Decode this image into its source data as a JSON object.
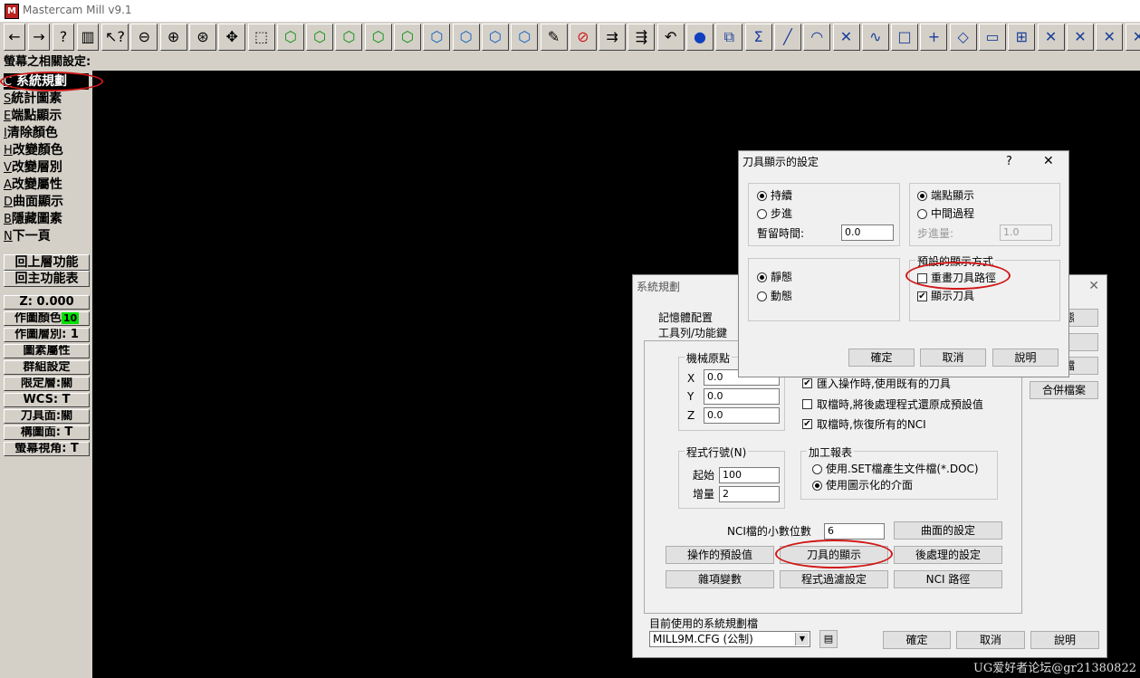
{
  "window": {
    "title": "Mastercam Mill v9.1"
  },
  "toolbar": {
    "buttons": [
      "←",
      "→",
      "?",
      "▥",
      "↖?",
      "⊖",
      "⊕",
      "⊛",
      "✥",
      "⬚",
      "⬡",
      "⬡",
      "⬡",
      "⬡",
      "⬡",
      "⬡",
      "⬡",
      "⬡",
      "⬡",
      "✎",
      "⊘",
      "⇉",
      "⇶",
      "↶",
      "●",
      "⧉",
      "Σ",
      "╱",
      "◠",
      "✕",
      "∿",
      "□",
      "+",
      "◇",
      "▭",
      "⊞",
      "✕",
      "✕",
      "✕",
      "✕"
    ]
  },
  "prompt": "螢幕之相關設定:",
  "left_menu": {
    "items": [
      {
        "key": "C",
        "label": "系統規劃"
      },
      {
        "key": "S",
        "label": "統計圖素"
      },
      {
        "key": "E",
        "label": "端點顯示"
      },
      {
        "key": "I",
        "label": "清除顏色"
      },
      {
        "key": "H",
        "label": "改變顏色"
      },
      {
        "key": "V",
        "label": "改變層別"
      },
      {
        "key": "A",
        "label": "改變屬性"
      },
      {
        "key": "D",
        "label": "曲面顯示"
      },
      {
        "key": "B",
        "label": "隱藏圖素"
      },
      {
        "key": "N",
        "label": "下一頁"
      }
    ],
    "nav": [
      "回上層功能",
      "回主功能表"
    ],
    "status": {
      "z": "Z:  0.000",
      "color": "作圖顏色",
      "color_value": "10",
      "level": "作圖層別:  1",
      "attributes": "圖素屬性",
      "group": "群組設定",
      "mask": "限定層:關",
      "wcs": "WCS:  T",
      "tplane": "刀具面:關",
      "cplane": "構圖面:  T",
      "gview": "螢幕視角:  T"
    }
  },
  "sys_dialog": {
    "title": "系統規劃",
    "tabs": [
      "記憶體配置",
      "工具列/功能鍵"
    ],
    "right_buttons": [
      "狀態",
      "...",
      "新檔",
      "合併檔案"
    ],
    "machine_origin": {
      "title": "機械原點",
      "labels": [
        "X",
        "Y",
        "Z"
      ],
      "values": [
        "0.0",
        "0.0",
        "0.0"
      ]
    },
    "checks": [
      {
        "label": "匯入操作時,使用既有的刀具",
        "checked": true
      },
      {
        "label": "取檔時,將後處理程式還原成預設值",
        "checked": false
      },
      {
        "label": "取檔時,恢復所有的NCI",
        "checked": true
      }
    ],
    "seq": {
      "title": "程式行號(N)",
      "start_label": "起始",
      "start_value": "100",
      "inc_label": "增量",
      "inc_value": "2"
    },
    "report": {
      "title": "加工報表",
      "opts": [
        "使用.SET檔產生文件檔(*.DOC)",
        "使用圖示化的介面"
      ],
      "selected": 1
    },
    "nci_decimals_label": "NCI檔的小數位數",
    "nci_decimals_value": "6",
    "btns": [
      "曲面的設定",
      "操作的預設值",
      "刀具的顯示",
      "後處理的設定",
      "雜項變數",
      "程式過濾設定",
      "NCI 路徑"
    ],
    "cfg_label": "目前使用的系統規劃檔",
    "cfg_value": "MILL9M.CFG (公制)",
    "ok": "確定",
    "cancel": "取消",
    "help": "說明"
  },
  "tool_dialog": {
    "title": "刀具顯示的設定",
    "help_glyph": "?",
    "close_glyph": "✕",
    "mode": {
      "opts": [
        "持續",
        "步進"
      ],
      "selected": 0,
      "pause_label": "暫留時間:",
      "pause_value": "0.0"
    },
    "display": {
      "opts": [
        "端點顯示",
        "中間過程"
      ],
      "selected": 0,
      "step_label": "步進量:",
      "step_value": "1.0"
    },
    "anim": {
      "opts": [
        "靜態",
        "動態"
      ],
      "selected": 0
    },
    "defaults": {
      "title": "預設的顯示方式",
      "checks": [
        {
          "label": "重畫刀具路徑",
          "checked": false
        },
        {
          "label": "顯示刀具",
          "checked": true
        }
      ]
    },
    "ok": "確定",
    "cancel": "取消",
    "help": "說明"
  },
  "watermark": "UG爱好者论坛@gr21380822"
}
